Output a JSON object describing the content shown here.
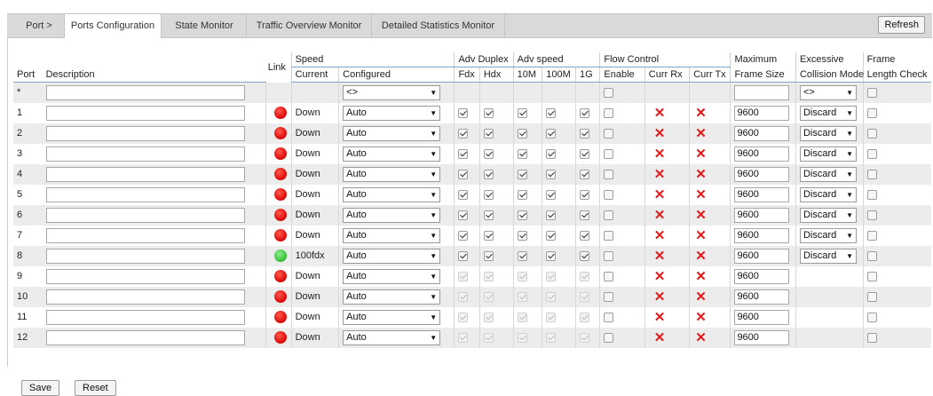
{
  "tabs": {
    "port": "Port  >",
    "ports_configuration": "Ports Configuration",
    "state_monitor": "State Monitor",
    "traffic_overview_monitor": "Traffic Overview Monitor",
    "detailed_statistics_monitor": "Detailed Statistics Monitor",
    "refresh": "Refresh"
  },
  "headers": {
    "port": "Port",
    "description": "Description",
    "link": "Link",
    "speed": "Speed",
    "current": "Current",
    "configured": "Configured",
    "adv_duplex": "Adv Duplex",
    "fdx": "Fdx",
    "hdx": "Hdx",
    "adv_speed": "Adv speed",
    "s10m": "10M",
    "s100m": "100M",
    "s1g": "1G",
    "flow_control": "Flow Control",
    "enable": "Enable",
    "curr_rx": "Curr Rx",
    "curr_tx": "Curr Tx",
    "maximum": "Maximum",
    "frame_size": "Frame Size",
    "excessive": "Excessive",
    "collision_mode": "Collision Mode",
    "frame": "Frame",
    "length_check": "Length Check"
  },
  "star_row": {
    "port": "*",
    "configured": "<>",
    "collision": "<>"
  },
  "rows": [
    {
      "port": "1",
      "current": "Down",
      "configured": "Auto",
      "frame_size": "9600",
      "collision": "Discard"
    },
    {
      "port": "2",
      "current": "Down",
      "configured": "Auto",
      "frame_size": "9600",
      "collision": "Discard"
    },
    {
      "port": "3",
      "current": "Down",
      "configured": "Auto",
      "frame_size": "9600",
      "collision": "Discard"
    },
    {
      "port": "4",
      "current": "Down",
      "configured": "Auto",
      "frame_size": "9600",
      "collision": "Discard"
    },
    {
      "port": "5",
      "current": "Down",
      "configured": "Auto",
      "frame_size": "9600",
      "collision": "Discard"
    },
    {
      "port": "6",
      "current": "Down",
      "configured": "Auto",
      "frame_size": "9600",
      "collision": "Discard"
    },
    {
      "port": "7",
      "current": "Down",
      "configured": "Auto",
      "frame_size": "9600",
      "collision": "Discard"
    },
    {
      "port": "8",
      "current": "100fdx",
      "configured": "Auto",
      "frame_size": "9600",
      "collision": "Discard"
    },
    {
      "port": "9",
      "current": "Down",
      "configured": "Auto",
      "frame_size": "9600",
      "collision": ""
    },
    {
      "port": "10",
      "current": "Down",
      "configured": "Auto",
      "frame_size": "9600",
      "collision": ""
    },
    {
      "port": "11",
      "current": "Down",
      "configured": "Auto",
      "frame_size": "9600",
      "collision": ""
    },
    {
      "port": "12",
      "current": "Down",
      "configured": "Auto",
      "frame_size": "9600",
      "collision": ""
    }
  ],
  "row_states": [
    {
      "link": "down",
      "adv_enabled": true,
      "has_collision": true
    },
    {
      "link": "down",
      "adv_enabled": true,
      "has_collision": true
    },
    {
      "link": "down",
      "adv_enabled": true,
      "has_collision": true
    },
    {
      "link": "down",
      "adv_enabled": true,
      "has_collision": true
    },
    {
      "link": "down",
      "adv_enabled": true,
      "has_collision": true
    },
    {
      "link": "down",
      "adv_enabled": true,
      "has_collision": true
    },
    {
      "link": "down",
      "adv_enabled": true,
      "has_collision": true
    },
    {
      "link": "up",
      "adv_enabled": true,
      "has_collision": true
    },
    {
      "link": "down",
      "adv_enabled": false,
      "has_collision": false
    },
    {
      "link": "down",
      "adv_enabled": false,
      "has_collision": false
    },
    {
      "link": "down",
      "adv_enabled": false,
      "has_collision": false
    },
    {
      "link": "down",
      "adv_enabled": false,
      "has_collision": false
    }
  ],
  "icons": {
    "link_down": "red-led-icon",
    "link_up": "green-led-icon",
    "flow_off": "red-x-icon",
    "dropdown": "dropdown-arrow-icon"
  },
  "colors": {
    "link_down": "#e01010",
    "link_up": "#3ec53e",
    "flow_x": "#e41a1a",
    "header_underline": "#7fa6c8"
  },
  "buttons": {
    "save": "Save",
    "reset": "Reset"
  }
}
